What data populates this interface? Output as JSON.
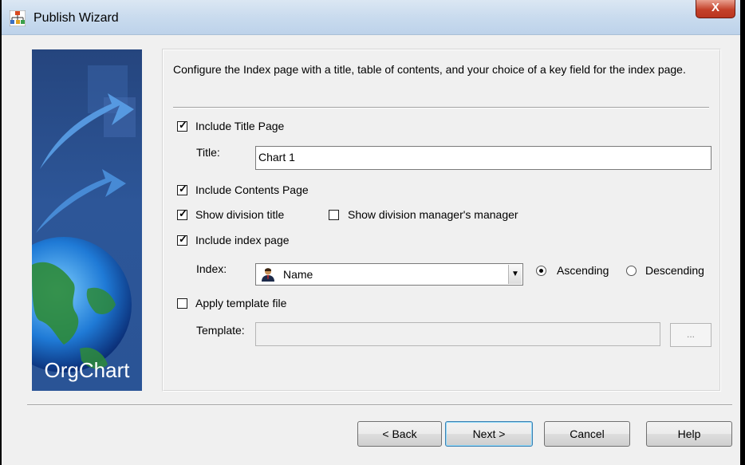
{
  "window": {
    "title": "Publish Wizard",
    "close_symbol": "X"
  },
  "banner": {
    "brand": "OrgChart"
  },
  "description": "Configure the Index page with a title, table of contents, and your choice of a key field for the index page.",
  "options": {
    "include_title_page": {
      "label": "Include Title Page",
      "checked": true
    },
    "title_label": "Title:",
    "title_value": "Chart 1",
    "include_contents_page": {
      "label": "Include Contents Page",
      "checked": true
    },
    "show_division_title": {
      "label": "Show division title",
      "checked": true
    },
    "show_division_managers_manager": {
      "label": "Show division manager's manager",
      "checked": false
    },
    "include_index_page": {
      "label": "Include index page",
      "checked": true
    },
    "index_label": "Index:",
    "index_value": "Name",
    "ascending_label": "Ascending",
    "descending_label": "Descending",
    "apply_template_file": {
      "label": "Apply template file",
      "checked": false
    },
    "template_label": "Template:",
    "template_value": "",
    "browse_label": "..."
  },
  "buttons": {
    "back": "< Back",
    "next": "Next >",
    "cancel": "Cancel",
    "help": "Help"
  },
  "icons": {
    "app": "orgchart-app-icon",
    "combo_item": "person-icon",
    "dropdown": "chevron-down-icon"
  },
  "colors": {
    "banner": "#2d5698",
    "default_button_border": "#3c7fb1",
    "close_button": "#c4412a"
  }
}
